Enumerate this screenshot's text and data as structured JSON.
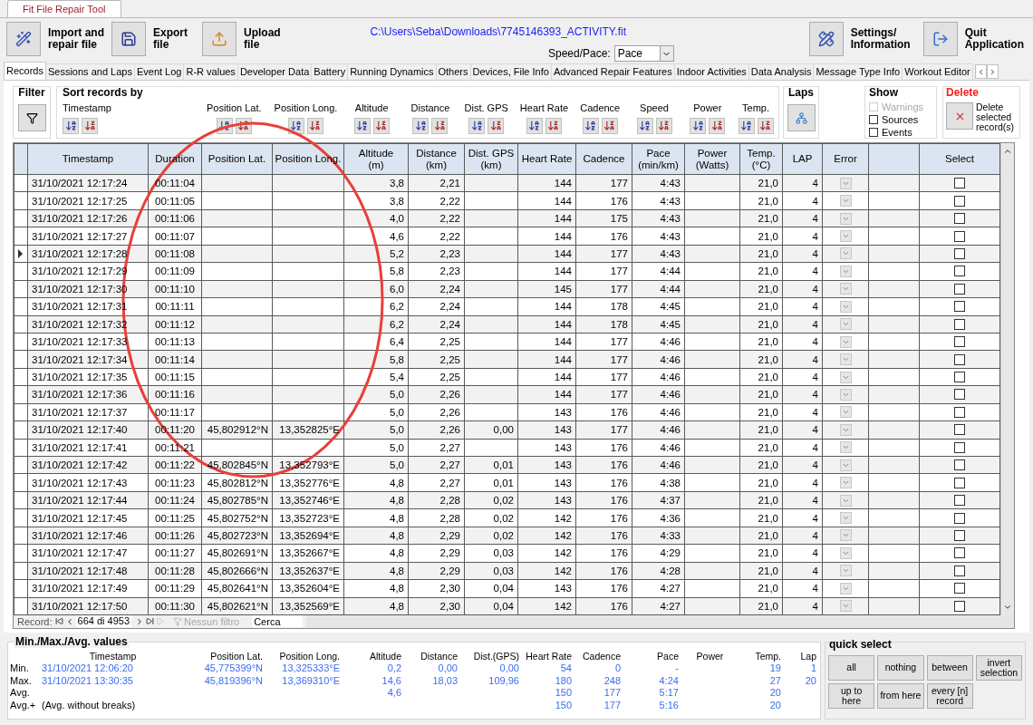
{
  "app_title": "Fit File Repair Tool",
  "toolbar": {
    "buttons": [
      {
        "label": "Import and\nrepair file",
        "kind": "import"
      },
      {
        "label": "Export\nfile",
        "kind": "export"
      },
      {
        "label": "Upload\nfile",
        "kind": "upload"
      }
    ],
    "file_path": "C:\\Users\\Seba\\Downloads\\7745146393_ACTIVITY.fit",
    "speed_pace": {
      "label": "Speed/Pace:",
      "value": "Pace"
    },
    "right_buttons": [
      {
        "label": "Settings/\nInformation",
        "kind": "settings"
      },
      {
        "label": "Quit\nApplication",
        "kind": "quit"
      }
    ]
  },
  "tabs": [
    {
      "label": "Records",
      "selected": true
    },
    {
      "label": "Sessions and Laps",
      "selected": false
    },
    {
      "label": "Event Log",
      "selected": false
    },
    {
      "label": "R-R values",
      "selected": false
    },
    {
      "label": "Developer Data",
      "selected": false
    },
    {
      "label": "Battery",
      "selected": false
    },
    {
      "label": "Running Dynamics",
      "selected": false
    },
    {
      "label": "Others",
      "selected": false
    },
    {
      "label": "Devices, File Info",
      "selected": false
    },
    {
      "label": "Advanced Repair Features",
      "selected": false
    },
    {
      "label": "Indoor Activities",
      "selected": false
    },
    {
      "label": "Data Analysis",
      "selected": false
    },
    {
      "label": "Message Type Info",
      "selected": false
    },
    {
      "label": "Workout Editor",
      "selected": false
    }
  ],
  "filter": {
    "title": "Filter"
  },
  "sort": {
    "title": "Sort records by",
    "fields": [
      "Timestamp",
      "Position Lat.",
      "Position Long.",
      "Altitude",
      "Distance",
      "Dist. GPS",
      "Heart Rate",
      "Cadence",
      "Speed",
      "Power",
      "Temp."
    ]
  },
  "laps": {
    "title": "Laps"
  },
  "show": {
    "title": "Show",
    "options": [
      {
        "label": "Warnings",
        "checked": false,
        "disabled": true
      },
      {
        "label": "Sources",
        "checked": false,
        "disabled": false
      },
      {
        "label": "Events",
        "checked": false,
        "disabled": false
      }
    ]
  },
  "delete": {
    "title": "Delete",
    "label": "Delete selected record(s)"
  },
  "table": {
    "columns": [
      "Timestamp",
      "Duration",
      "Position Lat.",
      "Position Long.",
      "Altitude\n(m)",
      "Distance\n(km)",
      "Dist. GPS\n(km)",
      "Heart Rate",
      "Cadence",
      "Pace\n(min/km)",
      "Power\n(Watts)",
      "Temp.\n(°C)",
      "LAP",
      "Error",
      "Select"
    ],
    "rows": [
      {
        "current": false,
        "selected": false,
        "timestamp": "31/10/2021 12:17:24",
        "duration": "00:11:04",
        "altitude": "3,8",
        "distance": "2,21",
        "heart_rate": "144",
        "cadence": "177",
        "pace": "4:43",
        "temp": "21,0",
        "lap": "4"
      },
      {
        "current": false,
        "selected": false,
        "timestamp": "31/10/2021 12:17:25",
        "duration": "00:11:05",
        "altitude": "3,8",
        "distance": "2,22",
        "heart_rate": "144",
        "cadence": "176",
        "pace": "4:43",
        "temp": "21,0",
        "lap": "4"
      },
      {
        "current": false,
        "selected": false,
        "timestamp": "31/10/2021 12:17:26",
        "duration": "00:11:06",
        "altitude": "4,0",
        "distance": "2,22",
        "heart_rate": "144",
        "cadence": "175",
        "pace": "4:43",
        "temp": "21,0",
        "lap": "4"
      },
      {
        "current": false,
        "selected": false,
        "timestamp": "31/10/2021 12:17:27",
        "duration": "00:11:07",
        "altitude": "4,6",
        "distance": "2,22",
        "heart_rate": "144",
        "cadence": "176",
        "pace": "4:43",
        "temp": "21,0",
        "lap": "4"
      },
      {
        "current": true,
        "selected": false,
        "timestamp": "31/10/2021 12:17:28",
        "duration": "00:11:08",
        "altitude": "5,2",
        "distance": "2,23",
        "heart_rate": "144",
        "cadence": "177",
        "pace": "4:43",
        "temp": "21,0",
        "lap": "4"
      },
      {
        "current": false,
        "selected": false,
        "timestamp": "31/10/2021 12:17:29",
        "duration": "00:11:09",
        "altitude": "5,8",
        "distance": "2,23",
        "heart_rate": "144",
        "cadence": "177",
        "pace": "4:44",
        "temp": "21,0",
        "lap": "4"
      },
      {
        "current": false,
        "selected": false,
        "timestamp": "31/10/2021 12:17:30",
        "duration": "00:11:10",
        "altitude": "6,0",
        "distance": "2,24",
        "heart_rate": "145",
        "cadence": "177",
        "pace": "4:44",
        "temp": "21,0",
        "lap": "4"
      },
      {
        "current": false,
        "selected": false,
        "timestamp": "31/10/2021 12:17:31",
        "duration": "00:11:11",
        "altitude": "6,2",
        "distance": "2,24",
        "heart_rate": "144",
        "cadence": "178",
        "pace": "4:45",
        "temp": "21,0",
        "lap": "4"
      },
      {
        "current": false,
        "selected": false,
        "timestamp": "31/10/2021 12:17:32",
        "duration": "00:11:12",
        "altitude": "6,2",
        "distance": "2,24",
        "heart_rate": "144",
        "cadence": "178",
        "pace": "4:45",
        "temp": "21,0",
        "lap": "4"
      },
      {
        "current": false,
        "selected": false,
        "timestamp": "31/10/2021 12:17:33",
        "duration": "00:11:13",
        "altitude": "6,4",
        "distance": "2,25",
        "heart_rate": "144",
        "cadence": "177",
        "pace": "4:46",
        "temp": "21,0",
        "lap": "4"
      },
      {
        "current": false,
        "selected": false,
        "timestamp": "31/10/2021 12:17:34",
        "duration": "00:11:14",
        "altitude": "5,8",
        "distance": "2,25",
        "heart_rate": "144",
        "cadence": "177",
        "pace": "4:46",
        "temp": "21,0",
        "lap": "4"
      },
      {
        "current": false,
        "selected": false,
        "timestamp": "31/10/2021 12:17:35",
        "duration": "00:11:15",
        "altitude": "5,4",
        "distance": "2,25",
        "heart_rate": "144",
        "cadence": "177",
        "pace": "4:46",
        "temp": "21,0",
        "lap": "4"
      },
      {
        "current": false,
        "selected": false,
        "timestamp": "31/10/2021 12:17:36",
        "duration": "00:11:16",
        "altitude": "5,0",
        "distance": "2,26",
        "heart_rate": "144",
        "cadence": "177",
        "pace": "4:46",
        "temp": "21,0",
        "lap": "4"
      },
      {
        "current": false,
        "selected": false,
        "timestamp": "31/10/2021 12:17:37",
        "duration": "00:11:17",
        "altitude": "5,0",
        "distance": "2,26",
        "heart_rate": "143",
        "cadence": "176",
        "pace": "4:46",
        "temp": "21,0",
        "lap": "4"
      },
      {
        "current": false,
        "selected": false,
        "timestamp": "31/10/2021 12:17:40",
        "duration": "00:11:20",
        "lat": "45,802912°N",
        "lon": "13,352825°E",
        "altitude": "5,0",
        "distance": "2,26",
        "dist_gps": "0,00",
        "heart_rate": "143",
        "cadence": "177",
        "pace": "4:46",
        "temp": "21,0",
        "lap": "4"
      },
      {
        "current": false,
        "selected": false,
        "timestamp": "31/10/2021 12:17:41",
        "duration": "00:11:21",
        "altitude": "5,0",
        "distance": "2,27",
        "heart_rate": "143",
        "cadence": "176",
        "pace": "4:46",
        "temp": "21,0",
        "lap": "4"
      },
      {
        "current": false,
        "selected": false,
        "timestamp": "31/10/2021 12:17:42",
        "duration": "00:11:22",
        "lat": "45,802845°N",
        "lon": "13,352793°E",
        "altitude": "5,0",
        "distance": "2,27",
        "dist_gps": "0,01",
        "heart_rate": "143",
        "cadence": "176",
        "pace": "4:46",
        "temp": "21,0",
        "lap": "4"
      },
      {
        "current": false,
        "selected": false,
        "timestamp": "31/10/2021 12:17:43",
        "duration": "00:11:23",
        "lat": "45,802812°N",
        "lon": "13,352776°E",
        "altitude": "4,8",
        "distance": "2,27",
        "dist_gps": "0,01",
        "heart_rate": "143",
        "cadence": "176",
        "pace": "4:38",
        "temp": "21,0",
        "lap": "4"
      },
      {
        "current": false,
        "selected": false,
        "timestamp": "31/10/2021 12:17:44",
        "duration": "00:11:24",
        "lat": "45,802785°N",
        "lon": "13,352746°E",
        "altitude": "4,8",
        "distance": "2,28",
        "dist_gps": "0,02",
        "heart_rate": "143",
        "cadence": "176",
        "pace": "4:37",
        "temp": "21,0",
        "lap": "4"
      },
      {
        "current": false,
        "selected": false,
        "timestamp": "31/10/2021 12:17:45",
        "duration": "00:11:25",
        "lat": "45,802752°N",
        "lon": "13,352723°E",
        "altitude": "4,8",
        "distance": "2,28",
        "dist_gps": "0,02",
        "heart_rate": "142",
        "cadence": "176",
        "pace": "4:36",
        "temp": "21,0",
        "lap": "4"
      },
      {
        "current": false,
        "selected": false,
        "timestamp": "31/10/2021 12:17:46",
        "duration": "00:11:26",
        "lat": "45,802723°N",
        "lon": "13,352694°E",
        "altitude": "4,8",
        "distance": "2,29",
        "dist_gps": "0,02",
        "heart_rate": "142",
        "cadence": "176",
        "pace": "4:33",
        "temp": "21,0",
        "lap": "4"
      },
      {
        "current": false,
        "selected": false,
        "timestamp": "31/10/2021 12:17:47",
        "duration": "00:11:27",
        "lat": "45,802691°N",
        "lon": "13,352667°E",
        "altitude": "4,8",
        "distance": "2,29",
        "dist_gps": "0,03",
        "heart_rate": "142",
        "cadence": "176",
        "pace": "4:29",
        "temp": "21,0",
        "lap": "4"
      },
      {
        "current": false,
        "selected": false,
        "timestamp": "31/10/2021 12:17:48",
        "duration": "00:11:28",
        "lat": "45,802666°N",
        "lon": "13,352637°E",
        "altitude": "4,8",
        "distance": "2,29",
        "dist_gps": "0,03",
        "heart_rate": "142",
        "cadence": "176",
        "pace": "4:28",
        "temp": "21,0",
        "lap": "4"
      },
      {
        "current": false,
        "selected": false,
        "timestamp": "31/10/2021 12:17:49",
        "duration": "00:11:29",
        "lat": "45,802641°N",
        "lon": "13,352604°E",
        "altitude": "4,8",
        "distance": "2,30",
        "dist_gps": "0,04",
        "heart_rate": "143",
        "cadence": "176",
        "pace": "4:27",
        "temp": "21,0",
        "lap": "4"
      },
      {
        "current": false,
        "selected": false,
        "timestamp": "31/10/2021 12:17:50",
        "duration": "00:11:30",
        "lat": "45,802621°N",
        "lon": "13,352569°E",
        "altitude": "4,8",
        "distance": "2,30",
        "dist_gps": "0,04",
        "heart_rate": "142",
        "cadence": "176",
        "pace": "4:27",
        "temp": "21,0",
        "lap": "4"
      }
    ]
  },
  "record_nav": {
    "label": "Record:",
    "position": "664 di 4953",
    "filter": "Nessun filtro",
    "search_placeholder": "Cerca"
  },
  "stats": {
    "title": "Min./Max./Avg. values",
    "columns": [
      "Timestamp",
      "Position Lat.",
      "Position Long.",
      "Altitude",
      "Distance",
      "Dist.(GPS)",
      "Heart Rate",
      "Cadence",
      "Pace",
      "Power",
      "Temp.",
      "Lap"
    ],
    "rows": [
      {
        "label": "Min.",
        "timestamp": "31/10/2021 12:06:20",
        "lat": "45,775399°N",
        "lon": "13,325333°E",
        "altitude": "0,2",
        "distance": "0,00",
        "dist_gps": "0,00",
        "heart_rate": "54",
        "cadence": "0",
        "pace": "-",
        "temp": "19",
        "lap": "1"
      },
      {
        "label": "Max.",
        "timestamp": "31/10/2021 13:30:35",
        "lat": "45,819396°N",
        "lon": "13,369310°E",
        "altitude": "14,6",
        "distance": "18,03",
        "dist_gps": "109,96",
        "heart_rate": "180",
        "cadence": "248",
        "pace": "4:24",
        "temp": "27",
        "lap": "20"
      },
      {
        "label": "Avg.",
        "altitude": "4,6",
        "heart_rate": "150",
        "cadence": "177",
        "pace": "5:17",
        "temp": "20"
      },
      {
        "label": "Avg.+",
        "note": "(Avg. without breaks)",
        "heart_rate": "150",
        "cadence": "177",
        "pace": "5:16",
        "temp": "20"
      }
    ]
  },
  "quick_select": {
    "title": "quick select",
    "buttons": [
      "all",
      "nothing",
      "between",
      "invert selection",
      "up to here",
      "from here",
      "every [n] record"
    ]
  }
}
